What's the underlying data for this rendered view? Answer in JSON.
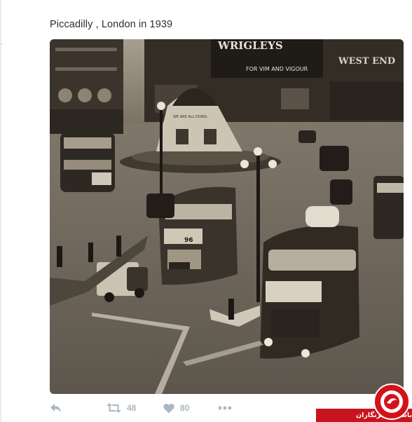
{
  "tweet": {
    "text": "Piccadilly , London in 1939"
  },
  "photo": {
    "signs": {
      "wrigleys": "WRIGLEYS",
      "vim": "FOR VIM AND VIGOUR",
      "westend": "WEST END"
    },
    "bus_route": "96"
  },
  "actions": {
    "retweet_count": "48",
    "like_count": "80"
  },
  "badge": {
    "label": "باشگاه خبرنگاران"
  },
  "colors": {
    "icon_gray": "#aab8c2",
    "badge_red": "#c8141e"
  }
}
